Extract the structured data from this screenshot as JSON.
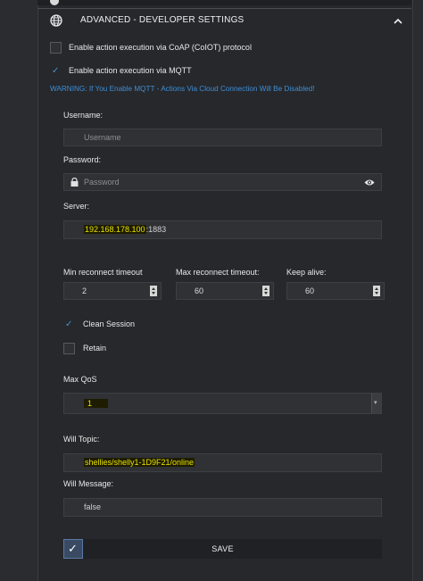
{
  "section": {
    "title": "ADVANCED - DEVELOPER SETTINGS"
  },
  "options": {
    "coap_label": "Enable action execution via CoAP (CoIOT) protocol",
    "coap_checked": false,
    "mqtt_label": "Enable action execution via MQTT",
    "mqtt_checked": true,
    "warning": "WARNING: If You Enable MQTT - Actions Via Cloud Connection Will Be Disabled!"
  },
  "form": {
    "username_label": "Username:",
    "username_placeholder": "Username",
    "password_label": "Password:",
    "password_placeholder": "Password",
    "server_label": "Server:",
    "server_ip": "192.168.178.100",
    "server_port": ":1883",
    "min_reconnect_label": "Min reconnect timeout",
    "min_reconnect_value": "2",
    "max_reconnect_label": "Max reconnect timeout:",
    "max_reconnect_value": "60",
    "keep_alive_label": "Keep alive:",
    "keep_alive_value": "60",
    "clean_session_label": "Clean Session",
    "clean_session_checked": true,
    "retain_label": "Retain",
    "retain_checked": false,
    "max_qos_label": "Max QoS",
    "max_qos_value": "1",
    "will_topic_label": "Will Topic:",
    "will_topic_value": "shellies/shelly1-1D9F21/online",
    "will_message_label": "Will Message:",
    "will_message_value": "false",
    "save_label": "SAVE"
  },
  "colors": {
    "accent": "#3f8ed6",
    "highlight": "#e9e200",
    "background": "#26282c"
  }
}
